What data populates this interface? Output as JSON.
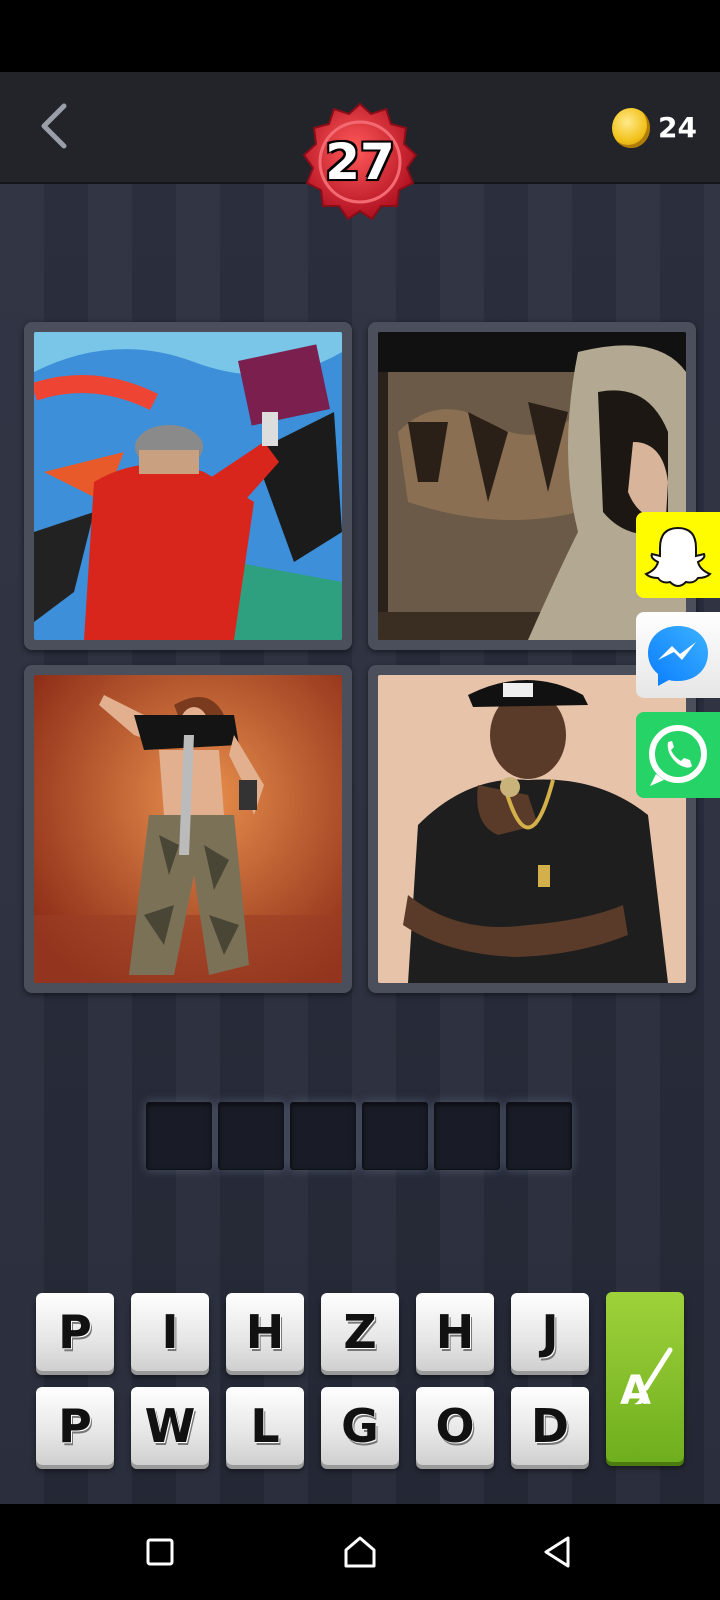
{
  "header": {
    "back_icon": "chevron-left-icon",
    "level": "27",
    "coins": "24",
    "coin_icon": "coin-icon"
  },
  "pictures": [
    {
      "name": "graffiti-spray-painter"
    },
    {
      "name": "hooded-figure-graffiti-wall"
    },
    {
      "name": "dancer-camo-pants"
    },
    {
      "name": "rapper-black-cap"
    }
  ],
  "answer": {
    "slot_count": 6
  },
  "keyboard": {
    "row1": [
      "P",
      "I",
      "H",
      "Z",
      "H",
      "J"
    ],
    "row2": [
      "P",
      "W",
      "L",
      "G",
      "O",
      "D"
    ],
    "hint_icon": "paintbrush-letter-icon"
  },
  "share": [
    "snapchat-icon",
    "messenger-icon",
    "whatsapp-icon"
  ],
  "colors": {
    "level_badge": "#e32636",
    "hint_button": "#8cc63f",
    "snapchat": "#fffc00",
    "whatsapp": "#25d366",
    "messenger": "#1d8cf8"
  },
  "navigation": [
    "recents-icon",
    "home-icon",
    "back-icon"
  ]
}
